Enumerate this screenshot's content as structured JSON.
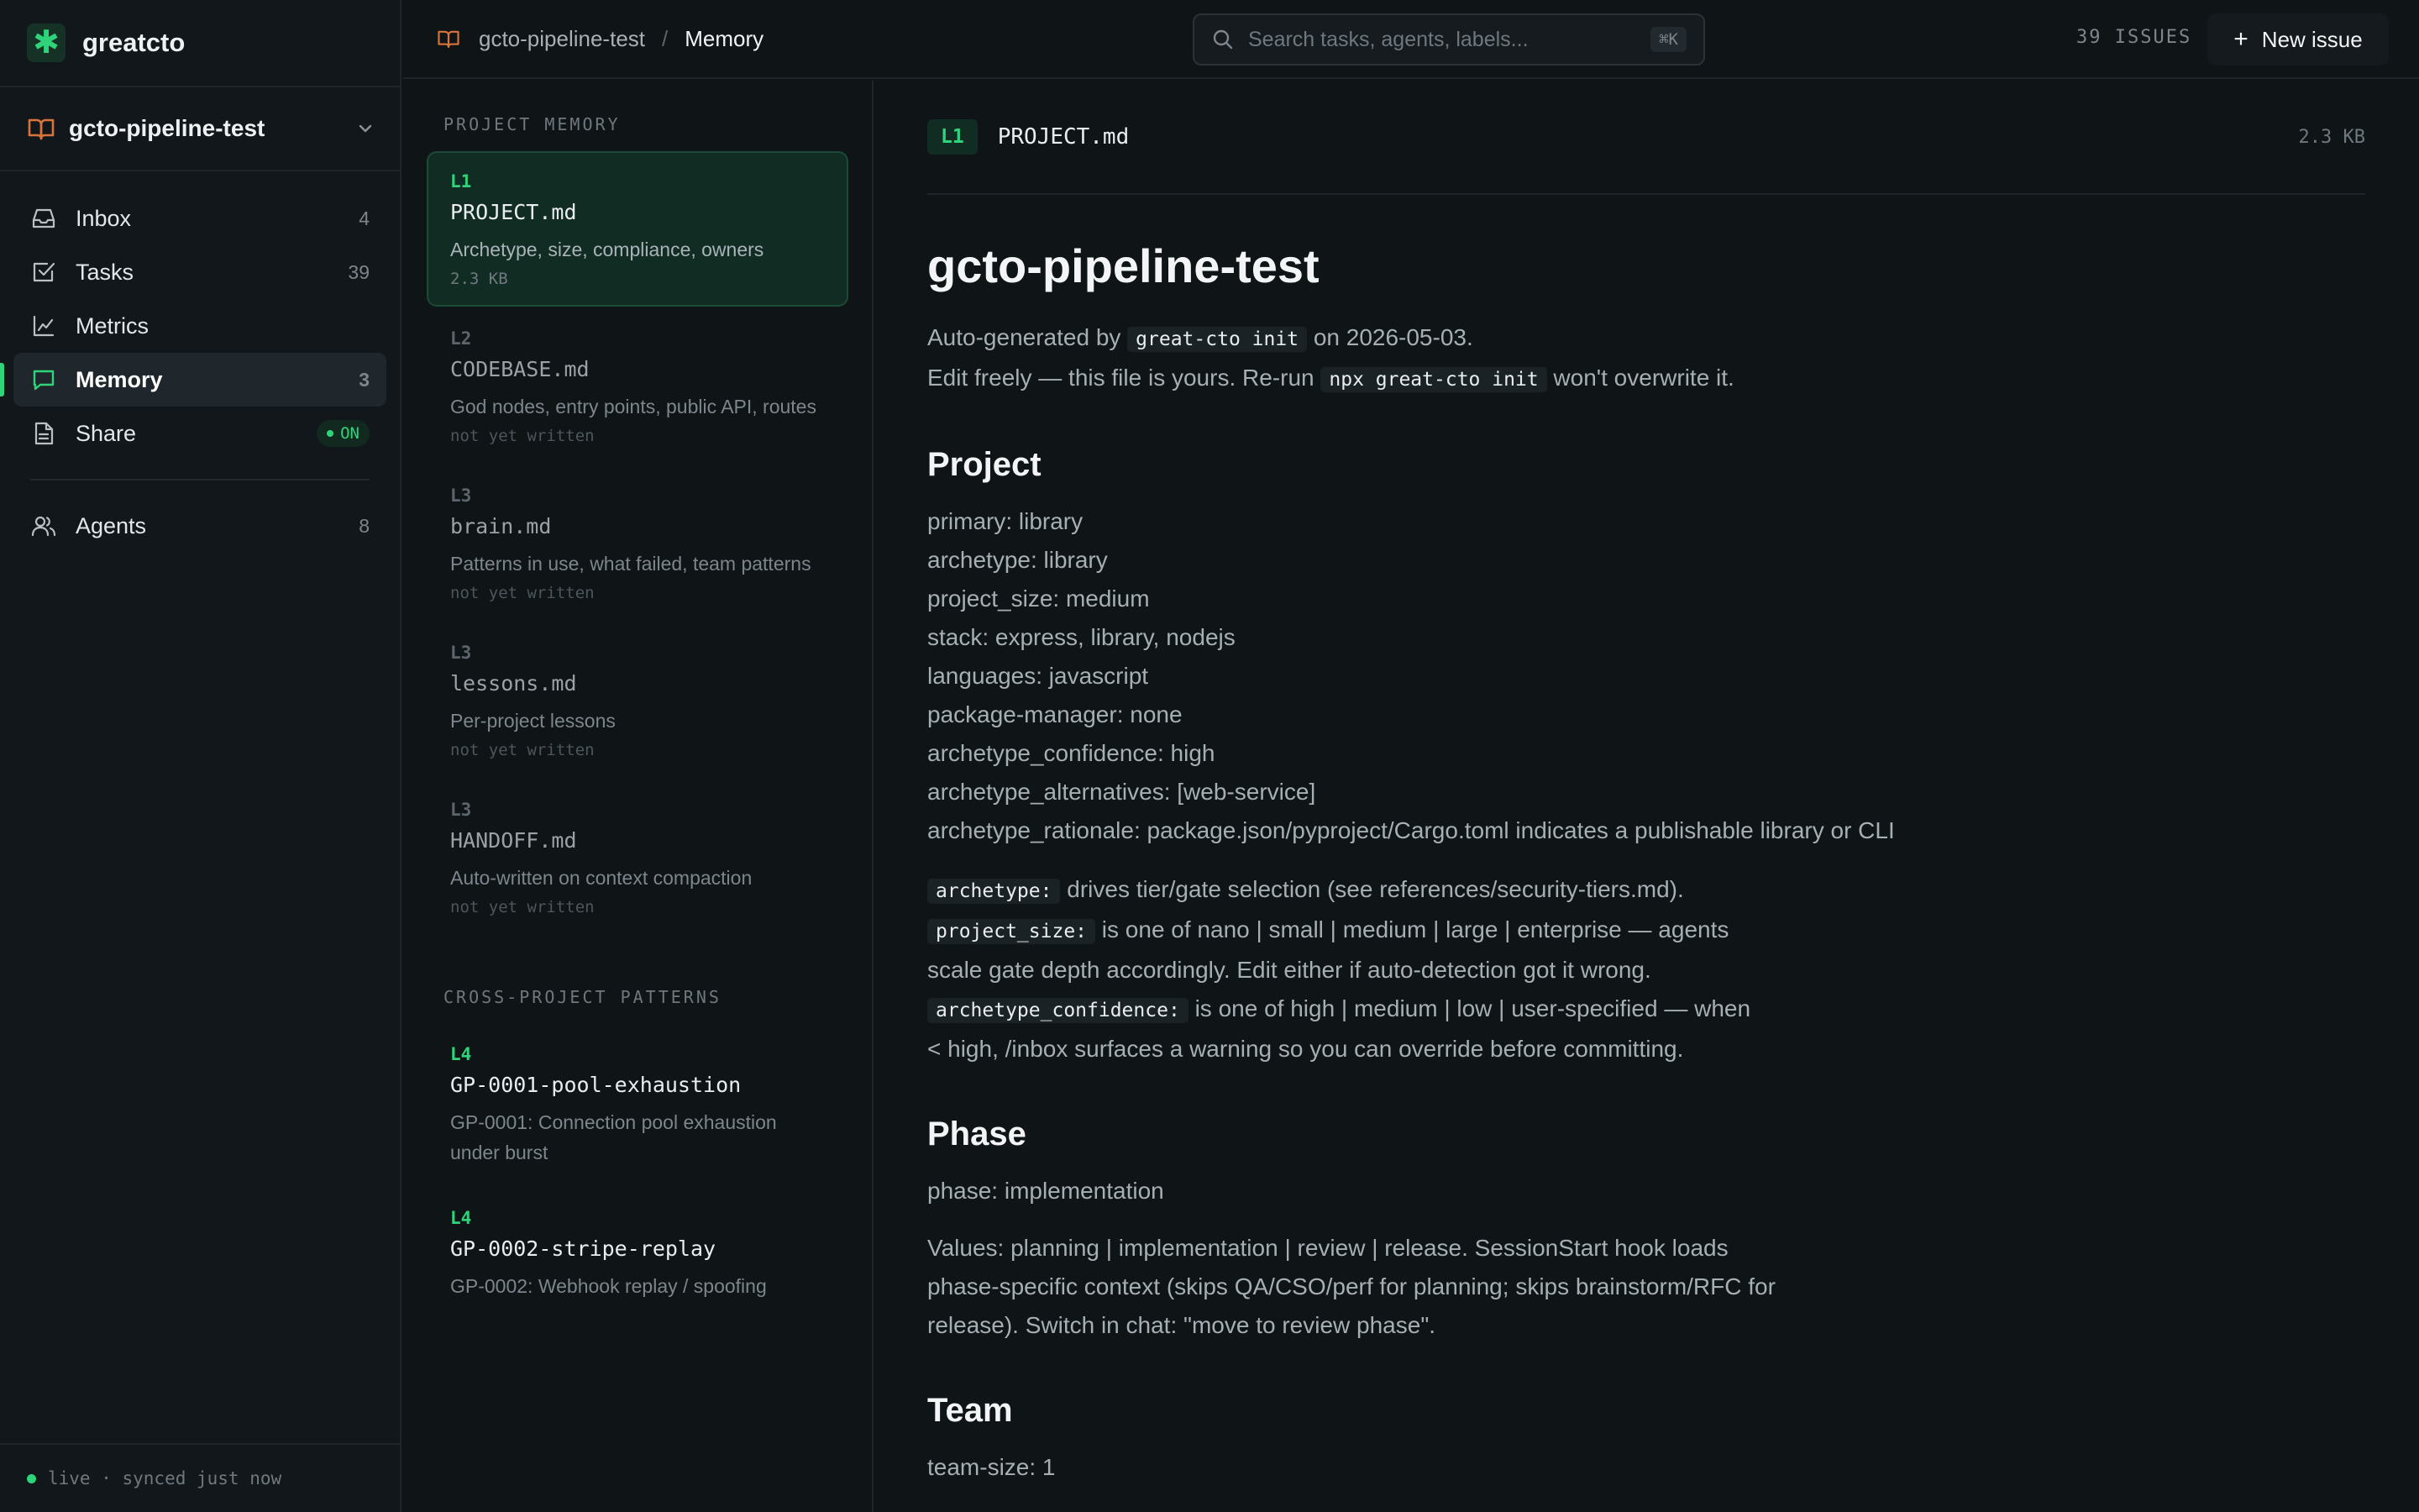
{
  "brand": {
    "name": "greatcto"
  },
  "project": {
    "name": "gcto-pipeline-test"
  },
  "nav": {
    "items": [
      {
        "label": "Inbox",
        "count": "4"
      },
      {
        "label": "Tasks",
        "count": "39"
      },
      {
        "label": "Metrics",
        "count": ""
      },
      {
        "label": "Memory",
        "count": "3"
      },
      {
        "label": "Share",
        "badge": "ON"
      }
    ],
    "agents": {
      "label": "Agents",
      "count": "8"
    }
  },
  "footer": {
    "status": "live · synced just now"
  },
  "topbar": {
    "breadcrumb_project": "gcto-pipeline-test",
    "breadcrumb_sep": "/",
    "breadcrumb_current": "Memory",
    "search_placeholder": "Search tasks, agents, labels...",
    "search_shortcut": "⌘K",
    "issues_count": "39 ISSUES",
    "new_issue_label": "New issue"
  },
  "filelist": {
    "project_title": "PROJECT MEMORY",
    "project_files": [
      {
        "level": "L1",
        "name": "PROJECT.md",
        "desc": "Archetype, size, compliance, owners",
        "meta": "2.3 KB"
      },
      {
        "level": "L2",
        "name": "CODEBASE.md",
        "desc": "God nodes, entry points, public API, routes",
        "meta": "not yet written"
      },
      {
        "level": "L3",
        "name": "brain.md",
        "desc": "Patterns in use, what failed, team patterns",
        "meta": "not yet written"
      },
      {
        "level": "L3",
        "name": "lessons.md",
        "desc": "Per-project lessons",
        "meta": "not yet written"
      },
      {
        "level": "L3",
        "name": "HANDOFF.md",
        "desc": "Auto-written on context compaction",
        "meta": "not yet written"
      }
    ],
    "cross_title": "CROSS-PROJECT PATTERNS",
    "cross_files": [
      {
        "level": "L4",
        "name": "GP-0001-pool-exhaustion",
        "desc": "GP-0001: Connection pool exhaustion under burst"
      },
      {
        "level": "L4",
        "name": "GP-0002-stripe-replay",
        "desc": "GP-0002: Webhook replay / spoofing"
      }
    ]
  },
  "doc": {
    "badge": "L1",
    "filename": "PROJECT.md",
    "size": "2.3 KB",
    "title": "gcto-pipeline-test",
    "intro": {
      "l1_pre": "Auto-generated by ",
      "l1_code": "great-cto init",
      "l1_post": " on 2026-05-03.",
      "l2_pre": "Edit freely — this file is yours. Re-run ",
      "l2_code": "npx great-cto init",
      "l2_post": " won't overwrite it."
    },
    "project_heading": "Project",
    "project_fields": [
      "primary: library",
      "archetype: library",
      "project_size: medium",
      "stack: express, library, nodejs",
      "languages: javascript",
      "package-manager: none",
      "archetype_confidence: high",
      "archetype_alternatives: [web-service]",
      "archetype_rationale: package.json/pyproject/Cargo.toml indicates a publishable library or CLI"
    ],
    "notes": {
      "n1_code": "archetype:",
      "n1_text": " drives tier/gate selection (see references/security-tiers.md).",
      "n2_code": "project_size:",
      "n2_text": " is one of nano | small | medium | large | enterprise — agents",
      "n2_cont": "scale gate depth accordingly. Edit either if auto-detection got it wrong.",
      "n3_code": "archetype_confidence:",
      "n3_text": " is one of high | medium | low | user-specified — when",
      "n3_cont": "< high, /inbox surfaces a warning so you can override before committing."
    },
    "phase_heading": "Phase",
    "phase_value": "phase: implementation",
    "phase_desc": "Values: planning | implementation | review | release. SessionStart hook loads phase-specific context (skips QA/CSO/perf for planning; skips brainstorm/RFC for release). Switch in chat: \"move to review phase\".",
    "team_heading": "Team",
    "team_value": "team-size: 1"
  },
  "colors": {
    "accent": "#2fd47a",
    "background": "#0f1417",
    "sidebar": "#12171b",
    "project_icon": "#d9753b"
  }
}
